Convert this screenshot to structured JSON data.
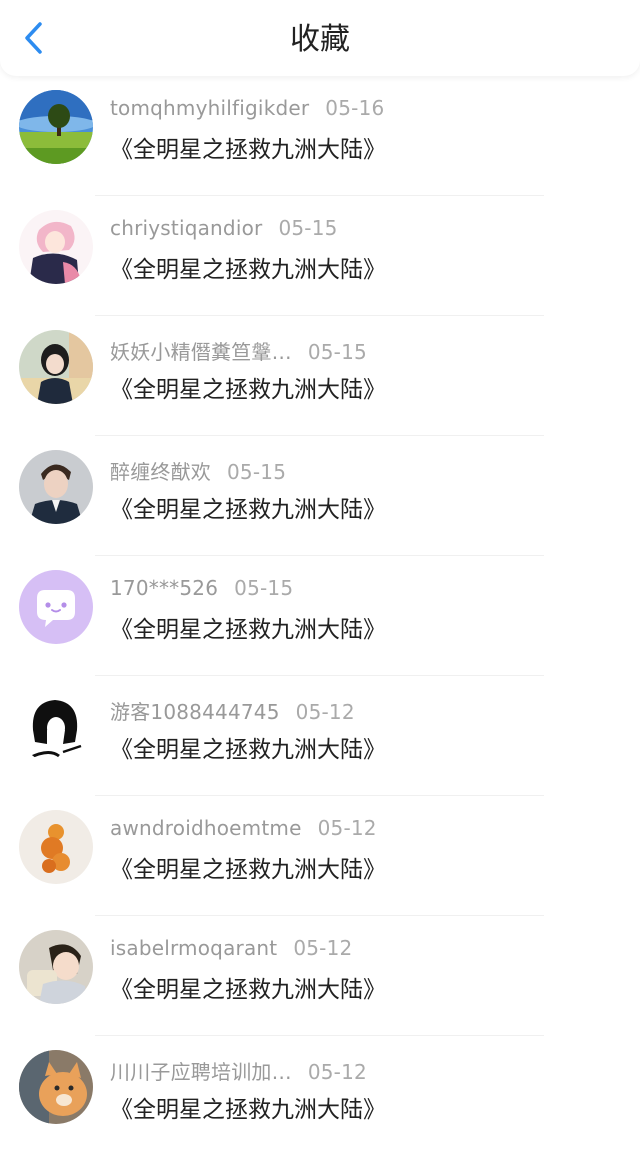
{
  "header": {
    "title": "收藏",
    "back_icon": "chevron-left-icon",
    "accent_color": "#2d8cf0"
  },
  "items": [
    {
      "user": "tomqhmyhilfigikder",
      "date": "05-16",
      "game": "《全明星之拯救九洲大陆》",
      "avatar": "landscape-tree"
    },
    {
      "user": "chriystiqandior",
      "date": "05-15",
      "game": "《全明星之拯救九洲大陆》",
      "avatar": "anime-girl"
    },
    {
      "user": "妖妖小精僭糞笪鞶…",
      "date": "05-15",
      "game": "《全明星之拯救九洲大陆》",
      "avatar": "child"
    },
    {
      "user": "醉缠终猷欢",
      "date": "05-15",
      "game": "《全明星之拯救九洲大陆》",
      "avatar": "man-portrait"
    },
    {
      "user": "170***526",
      "date": "05-15",
      "game": "《全明星之拯救九洲大陆》",
      "avatar": "default-chat"
    },
    {
      "user": "游客1088444745",
      "date": "05-12",
      "game": "《全明星之拯救九洲大陆》",
      "avatar": "sketch-girl"
    },
    {
      "user": "awndroidhoemtme",
      "date": "05-12",
      "game": "《全明星之拯救九洲大陆》",
      "avatar": "orange-fruit"
    },
    {
      "user": "isabelrmoqarant",
      "date": "05-12",
      "game": "《全明星之拯救九洲大陆》",
      "avatar": "baby"
    },
    {
      "user": "川川子应聘培训加…",
      "date": "05-12",
      "game": "《全明星之拯救九洲大陆》",
      "avatar": "cat"
    }
  ]
}
